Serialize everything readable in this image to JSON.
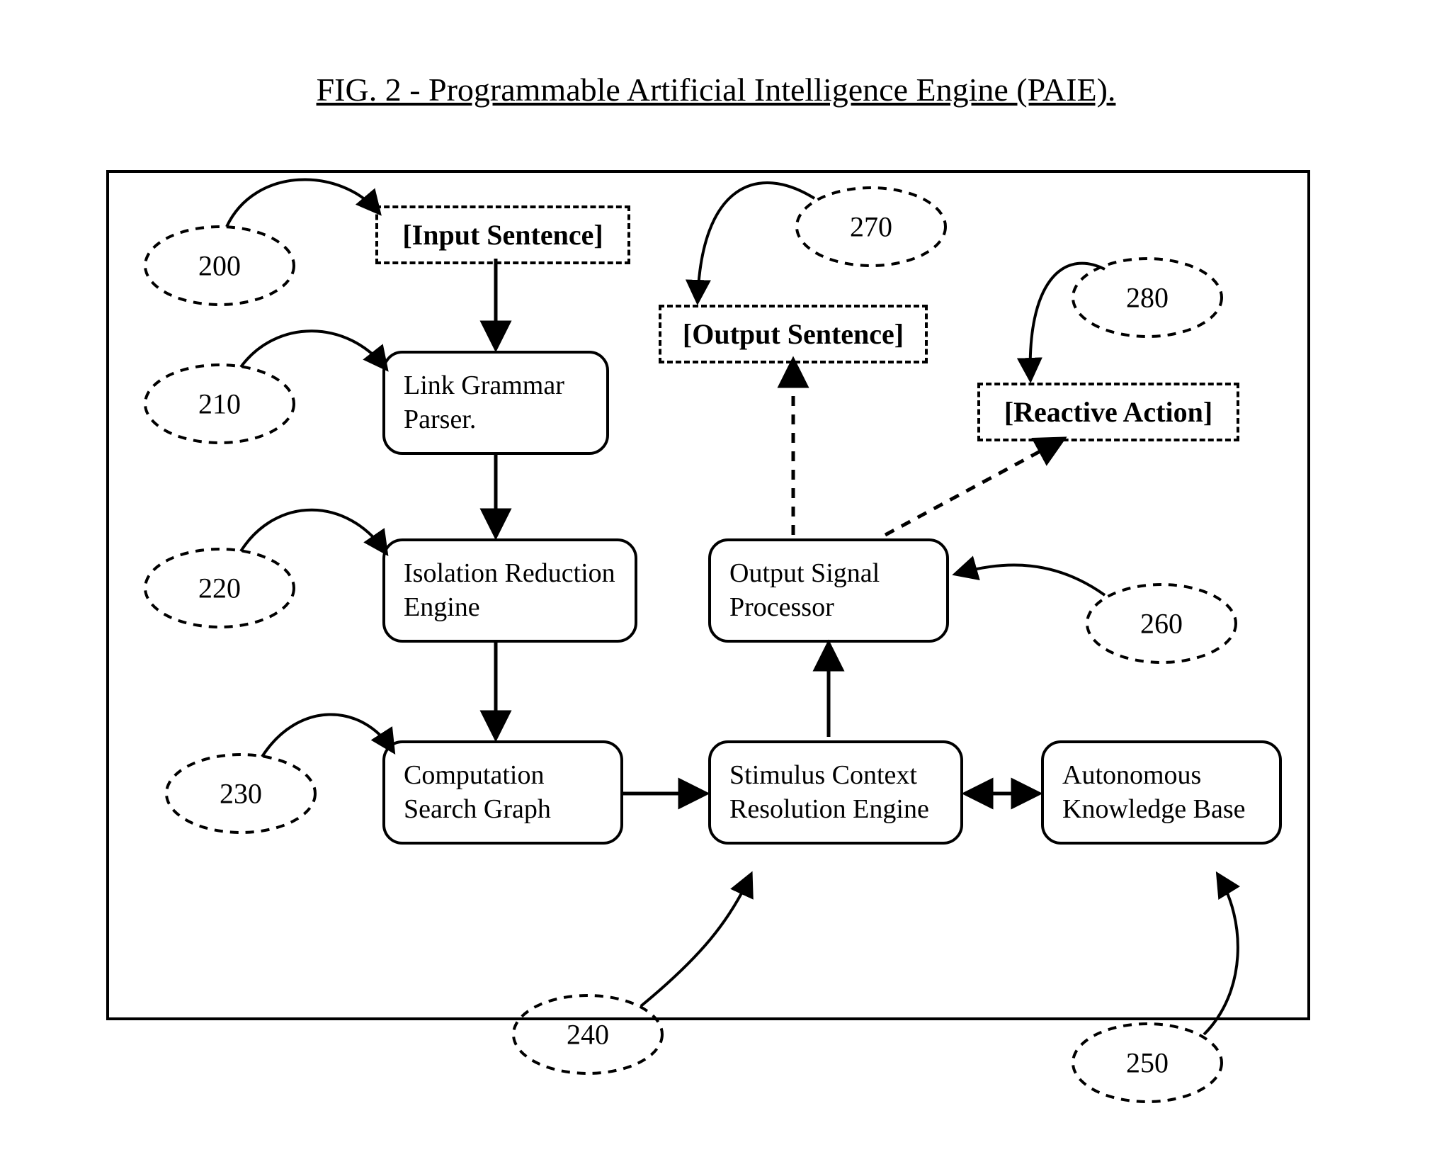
{
  "title": "FIG. 2 - Programmable Artificial Intelligence Engine (PAIE).",
  "nodes": {
    "input_sentence": "[Input Sentence]",
    "output_sentence": "[Output Sentence]",
    "reactive_action": "[Reactive Action]",
    "link_grammar_parser": "Link Grammar Parser.",
    "isolation_reduction": "Isolation Reduction Engine",
    "computation_search_graph": "Computation Search Graph",
    "stimulus_context": "Stimulus Context Resolution Engine",
    "output_signal_processor": "Output Signal Processor",
    "autonomous_kb": "Autonomous Knowledge Base"
  },
  "refs": {
    "r200": "200",
    "r210": "210",
    "r220": "220",
    "r230": "230",
    "r240": "240",
    "r250": "250",
    "r260": "260",
    "r270": "270",
    "r280": "280"
  }
}
